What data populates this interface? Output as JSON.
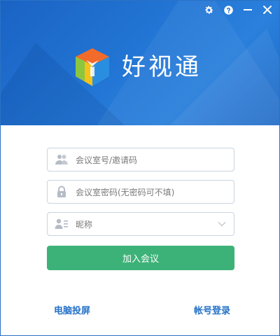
{
  "app": {
    "name": "好视通"
  },
  "window_controls": {
    "settings_icon": "gear-icon",
    "help_icon": "help-circle-icon",
    "minimize_icon": "minimize-icon",
    "close_icon": "close-icon"
  },
  "form": {
    "room_field": {
      "placeholder": "会议室号/邀请码",
      "icon": "users-icon"
    },
    "password_field": {
      "placeholder": "会议室密码(无密码可不填)",
      "icon": "lock-icon"
    },
    "nickname_field": {
      "placeholder": "昵称",
      "icon": "user-list-icon",
      "dropdown_icon": "chevron-down-icon"
    },
    "join_button": "加入会议"
  },
  "footer": {
    "screen_share_link": "电脑投屏",
    "account_login_link": "帐号登录"
  },
  "colors": {
    "header_blue": "#1f6fcf",
    "join_green": "#3db278",
    "link_blue": "#2472c8",
    "logo_orange": "#f26b2a",
    "logo_yellow": "#f4c21a",
    "logo_green": "#8cc63f",
    "logo_blue": "#2a8ee0"
  }
}
